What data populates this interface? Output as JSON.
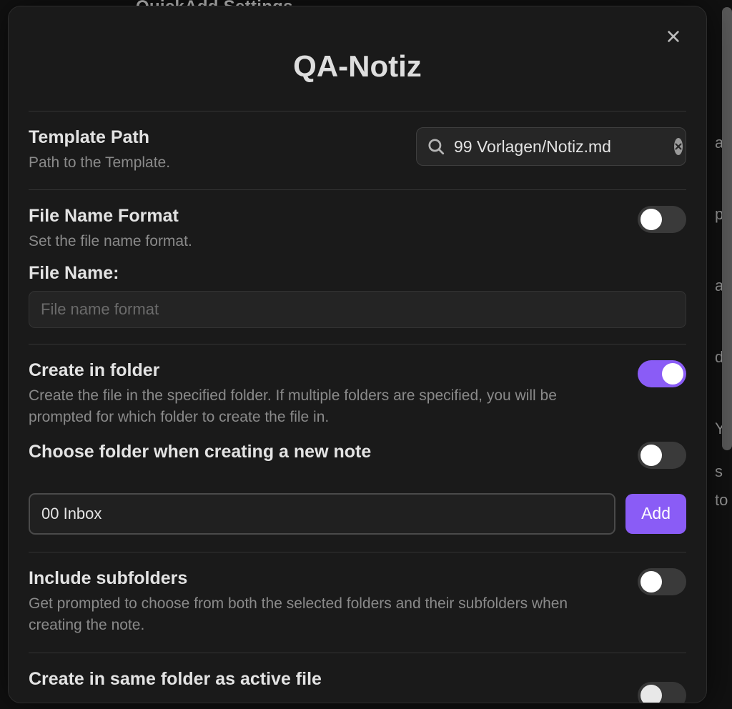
{
  "background": {
    "title": "QuickAdd Settings",
    "right_fragments": [
      "at",
      "p",
      "at",
      "d",
      "Yo",
      "s",
      "to"
    ]
  },
  "modal": {
    "title": "QA-Notiz",
    "template_path": {
      "title": "Template Path",
      "desc": "Path to the Template.",
      "value": "99 Vorlagen/Notiz.md"
    },
    "file_name_format": {
      "title": "File Name Format",
      "desc": "Set the file name format.",
      "enabled": false,
      "sublabel": "File Name:",
      "placeholder": "File name format",
      "value": ""
    },
    "create_in_folder": {
      "title": "Create in folder",
      "desc": "Create the file in the specified folder. If multiple folders are specified, you will be prompted for which folder to create the file in.",
      "enabled": true
    },
    "choose_folder": {
      "title": "Choose folder when creating a new note",
      "enabled": false
    },
    "folder_input": {
      "value": "00 Inbox",
      "add_label": "Add"
    },
    "include_subfolders": {
      "title": "Include subfolders",
      "desc": "Get prompted to choose from both the selected folders and their subfolders when creating the note.",
      "enabled": false
    },
    "same_folder_active": {
      "title": "Create in same folder as active file"
    }
  }
}
